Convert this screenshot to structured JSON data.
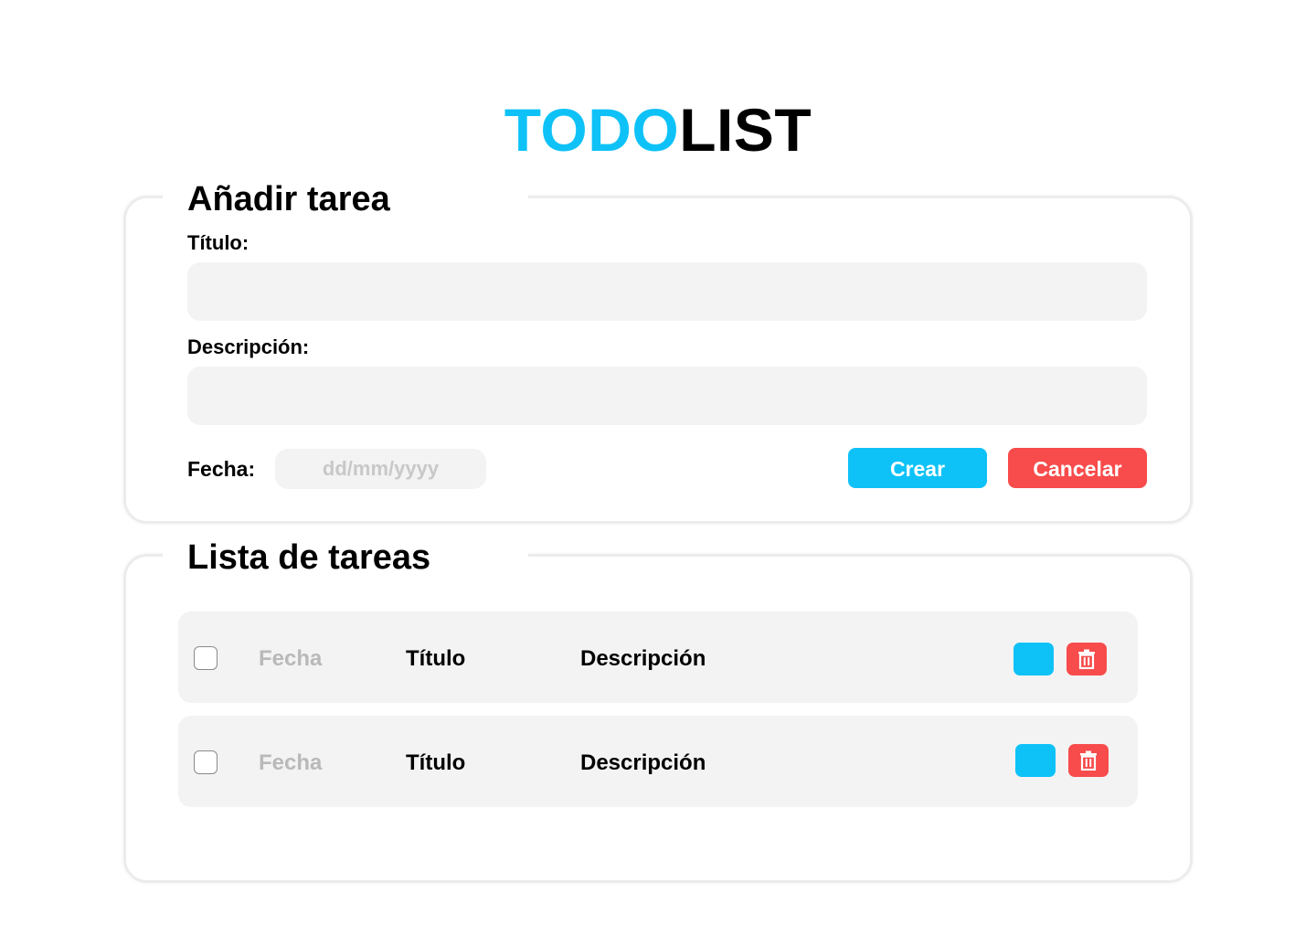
{
  "header": {
    "title_accent": "TODO",
    "title_rest": "LIST"
  },
  "add_task": {
    "heading": "Añadir tarea",
    "title_label": "Título:",
    "title_value": "",
    "description_label": "Descripción:",
    "description_value": "",
    "date_label": "Fecha:",
    "date_placeholder": "dd/mm/yyyy",
    "create_label": "Crear",
    "cancel_label": "Cancelar"
  },
  "task_list": {
    "heading": "Lista de tareas",
    "tasks": [
      {
        "checked": false,
        "date": "Fecha",
        "title": "Título",
        "description": "Descripción",
        "edit_icon": "edit-icon",
        "delete_icon": "trash-icon"
      },
      {
        "checked": false,
        "date": "Fecha",
        "title": "Título",
        "description": "Descripción",
        "edit_icon": "edit-icon",
        "delete_icon": "trash-icon"
      }
    ]
  },
  "colors": {
    "accent": "#0ec2f7",
    "danger": "#f84b4b",
    "field_background": "#f4f3f4",
    "muted_text": "#b9b9b9"
  }
}
